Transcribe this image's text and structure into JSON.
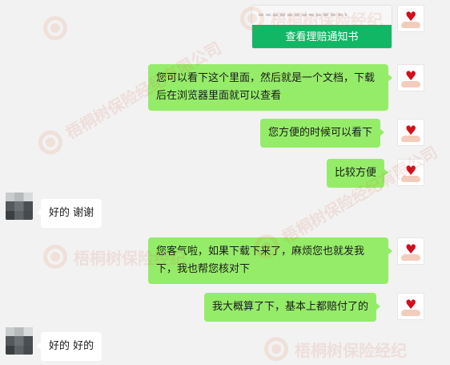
{
  "card": {
    "button_label": "查看理赔通知书"
  },
  "messages": [
    {
      "text": "您可以看下这个里面，然后就是一个文档，下载后在浏览器里面就可以查看"
    },
    {
      "text": "您方便的时候可以看下"
    },
    {
      "text": "比较方便"
    },
    {
      "text": "好的 谢谢"
    },
    {
      "text": "您客气啦，如果下载下来了，麻烦您也就发我下，我也帮您核对下"
    },
    {
      "text": "我大概算了下，基本上都赔付了的"
    },
    {
      "text": "好的 好的"
    }
  ],
  "watermarks": [
    {
      "text": "梧桐树保险经纪"
    },
    {
      "text": "梧桐树保险经纪有限公司"
    },
    {
      "text": "梧桐树保险经纪"
    },
    {
      "text": "梧桐树保险经纪有限公司"
    },
    {
      "text": "梧桐树保险经纪"
    },
    {
      "text": "梧桐树保险经纪"
    }
  ],
  "icons": {
    "self_avatar": "heart-in-hand-icon",
    "bubble_accent": "#95ec69",
    "card_button_color": "#12b765"
  }
}
